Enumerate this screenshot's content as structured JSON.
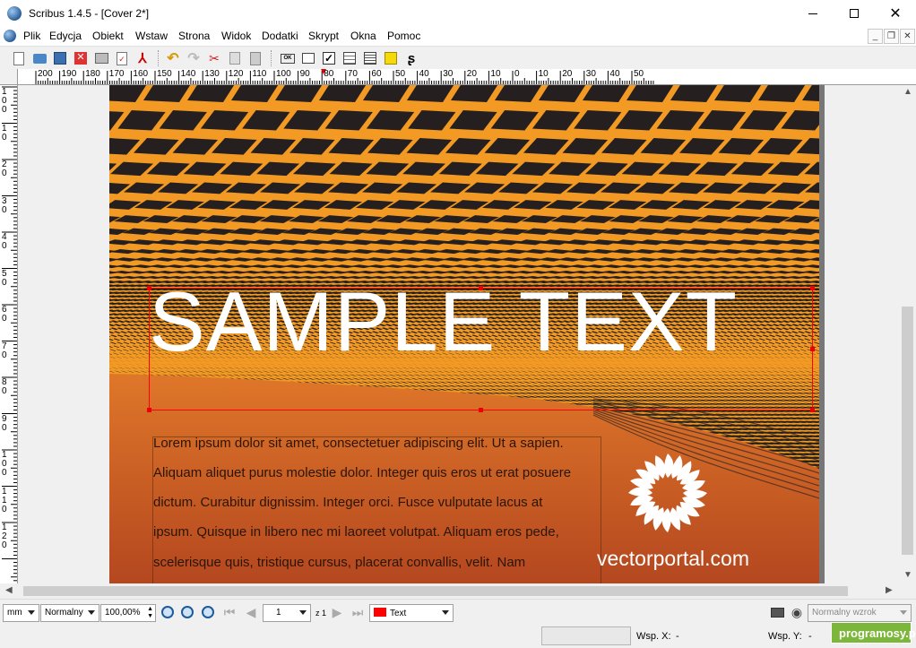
{
  "window": {
    "title": "Scribus 1.4.5 - [Cover 2*]",
    "minimize_icon": "minimize-icon",
    "maximize_icon": "maximize-icon",
    "close_icon": "close-icon"
  },
  "menu": {
    "items": [
      "Plik",
      "Edycja",
      "Obiekt",
      "Wstaw",
      "Strona",
      "Widok",
      "Dodatki",
      "Skrypt",
      "Okna",
      "Pomoc"
    ]
  },
  "toolbar": {
    "icons": [
      "new-document-icon",
      "open-icon",
      "save-icon",
      "close-document-icon",
      "print-icon",
      "preflight-icon",
      "export-pdf-icon",
      "undo-icon",
      "redo-icon",
      "cut-icon",
      "copy-icon",
      "paste-icon",
      "ok-icon",
      "text-frame-icon",
      "checkbox-icon",
      "list-icon",
      "grid-icon",
      "sticky-note-icon",
      "link-icon"
    ]
  },
  "ruler": {
    "h_labels": [
      "200",
      "190",
      "180",
      "170",
      "160",
      "150",
      "140",
      "130",
      "120",
      "110",
      "100",
      "90",
      "80",
      "70",
      "60",
      "50",
      "40",
      "30",
      "20",
      "10",
      "0",
      "10",
      "20",
      "30",
      "40",
      "50"
    ],
    "v_labels": [
      "1 0 0",
      "1 0",
      "2 0",
      "3 0",
      "4 0",
      "5 0",
      "6 0",
      "7 0",
      "8 0",
      "9 0",
      "1 0 0",
      "1 1 0",
      "1 2 0"
    ]
  },
  "document": {
    "headline": "SAMPLE TEXT",
    "body_lines": [
      "Lorem ipsum dolor sit amet, consectetuer adipiscing elit. Ut a sapien.",
      "Aliquam aliquet purus molestie dolor. Integer quis eros ut erat posuere",
      "dictum. Curabitur dignissim. Integer orci. Fusce vulputate lacus at",
      "ipsum. Quisque in libero nec mi laoreet volutpat. Aliquam eros pede,",
      "scelerisque quis, tristique cursus, placerat convallis, velit. Nam"
    ],
    "logo_text": "vectorportal.com",
    "colors": {
      "grid": "#f39a24",
      "dark": "#25201f",
      "bg_top": "#e27a2a",
      "bg_bottom": "#b4471f"
    }
  },
  "status": {
    "unit": "mm",
    "mode": "Normalny",
    "zoom": "100,00%",
    "page_number": "1",
    "page_of": "z 1",
    "layer": "Text",
    "layer_color": "#ff0000",
    "view_mode": "Normalny wzrok",
    "x_label": "Wsp. X:",
    "x_value": "-",
    "y_label": "Wsp. Y:",
    "y_value": "-",
    "watermark": "programosy.pl"
  }
}
